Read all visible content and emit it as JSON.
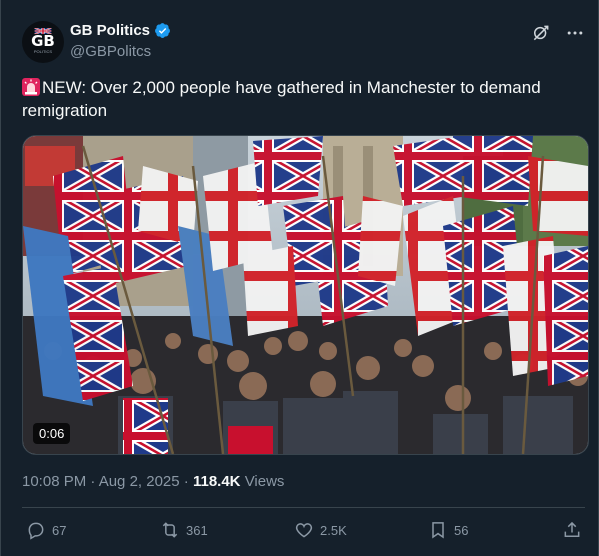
{
  "account": {
    "display_name": "GB Politics",
    "handle": "@GBPolitcs",
    "avatar_text": "GB",
    "avatar_subtext": "POLITICS",
    "verified": true
  },
  "post": {
    "text": "NEW: Over 2,000 people have gathered in Manchester to demand remigration",
    "media_duration": "0:06",
    "timestamp": "10:08 PM · Aug 2, 2025",
    "meta_separator": "·",
    "views_count": "118.4K",
    "views_label": "Views"
  },
  "actions": {
    "replies": "67",
    "reposts": "361",
    "likes": "2.5K",
    "bookmarks": "56"
  },
  "colors": {
    "background": "#15202b",
    "text_primary": "#f7f9f9",
    "text_secondary": "#8b98a5",
    "verified_blue": "#1d9bf0",
    "divider": "#38444d"
  },
  "icons": [
    "verified-badge-icon",
    "grok-icon",
    "more-icon",
    "siren-icon",
    "reply-icon",
    "repost-icon",
    "like-icon",
    "bookmark-icon",
    "share-icon"
  ]
}
